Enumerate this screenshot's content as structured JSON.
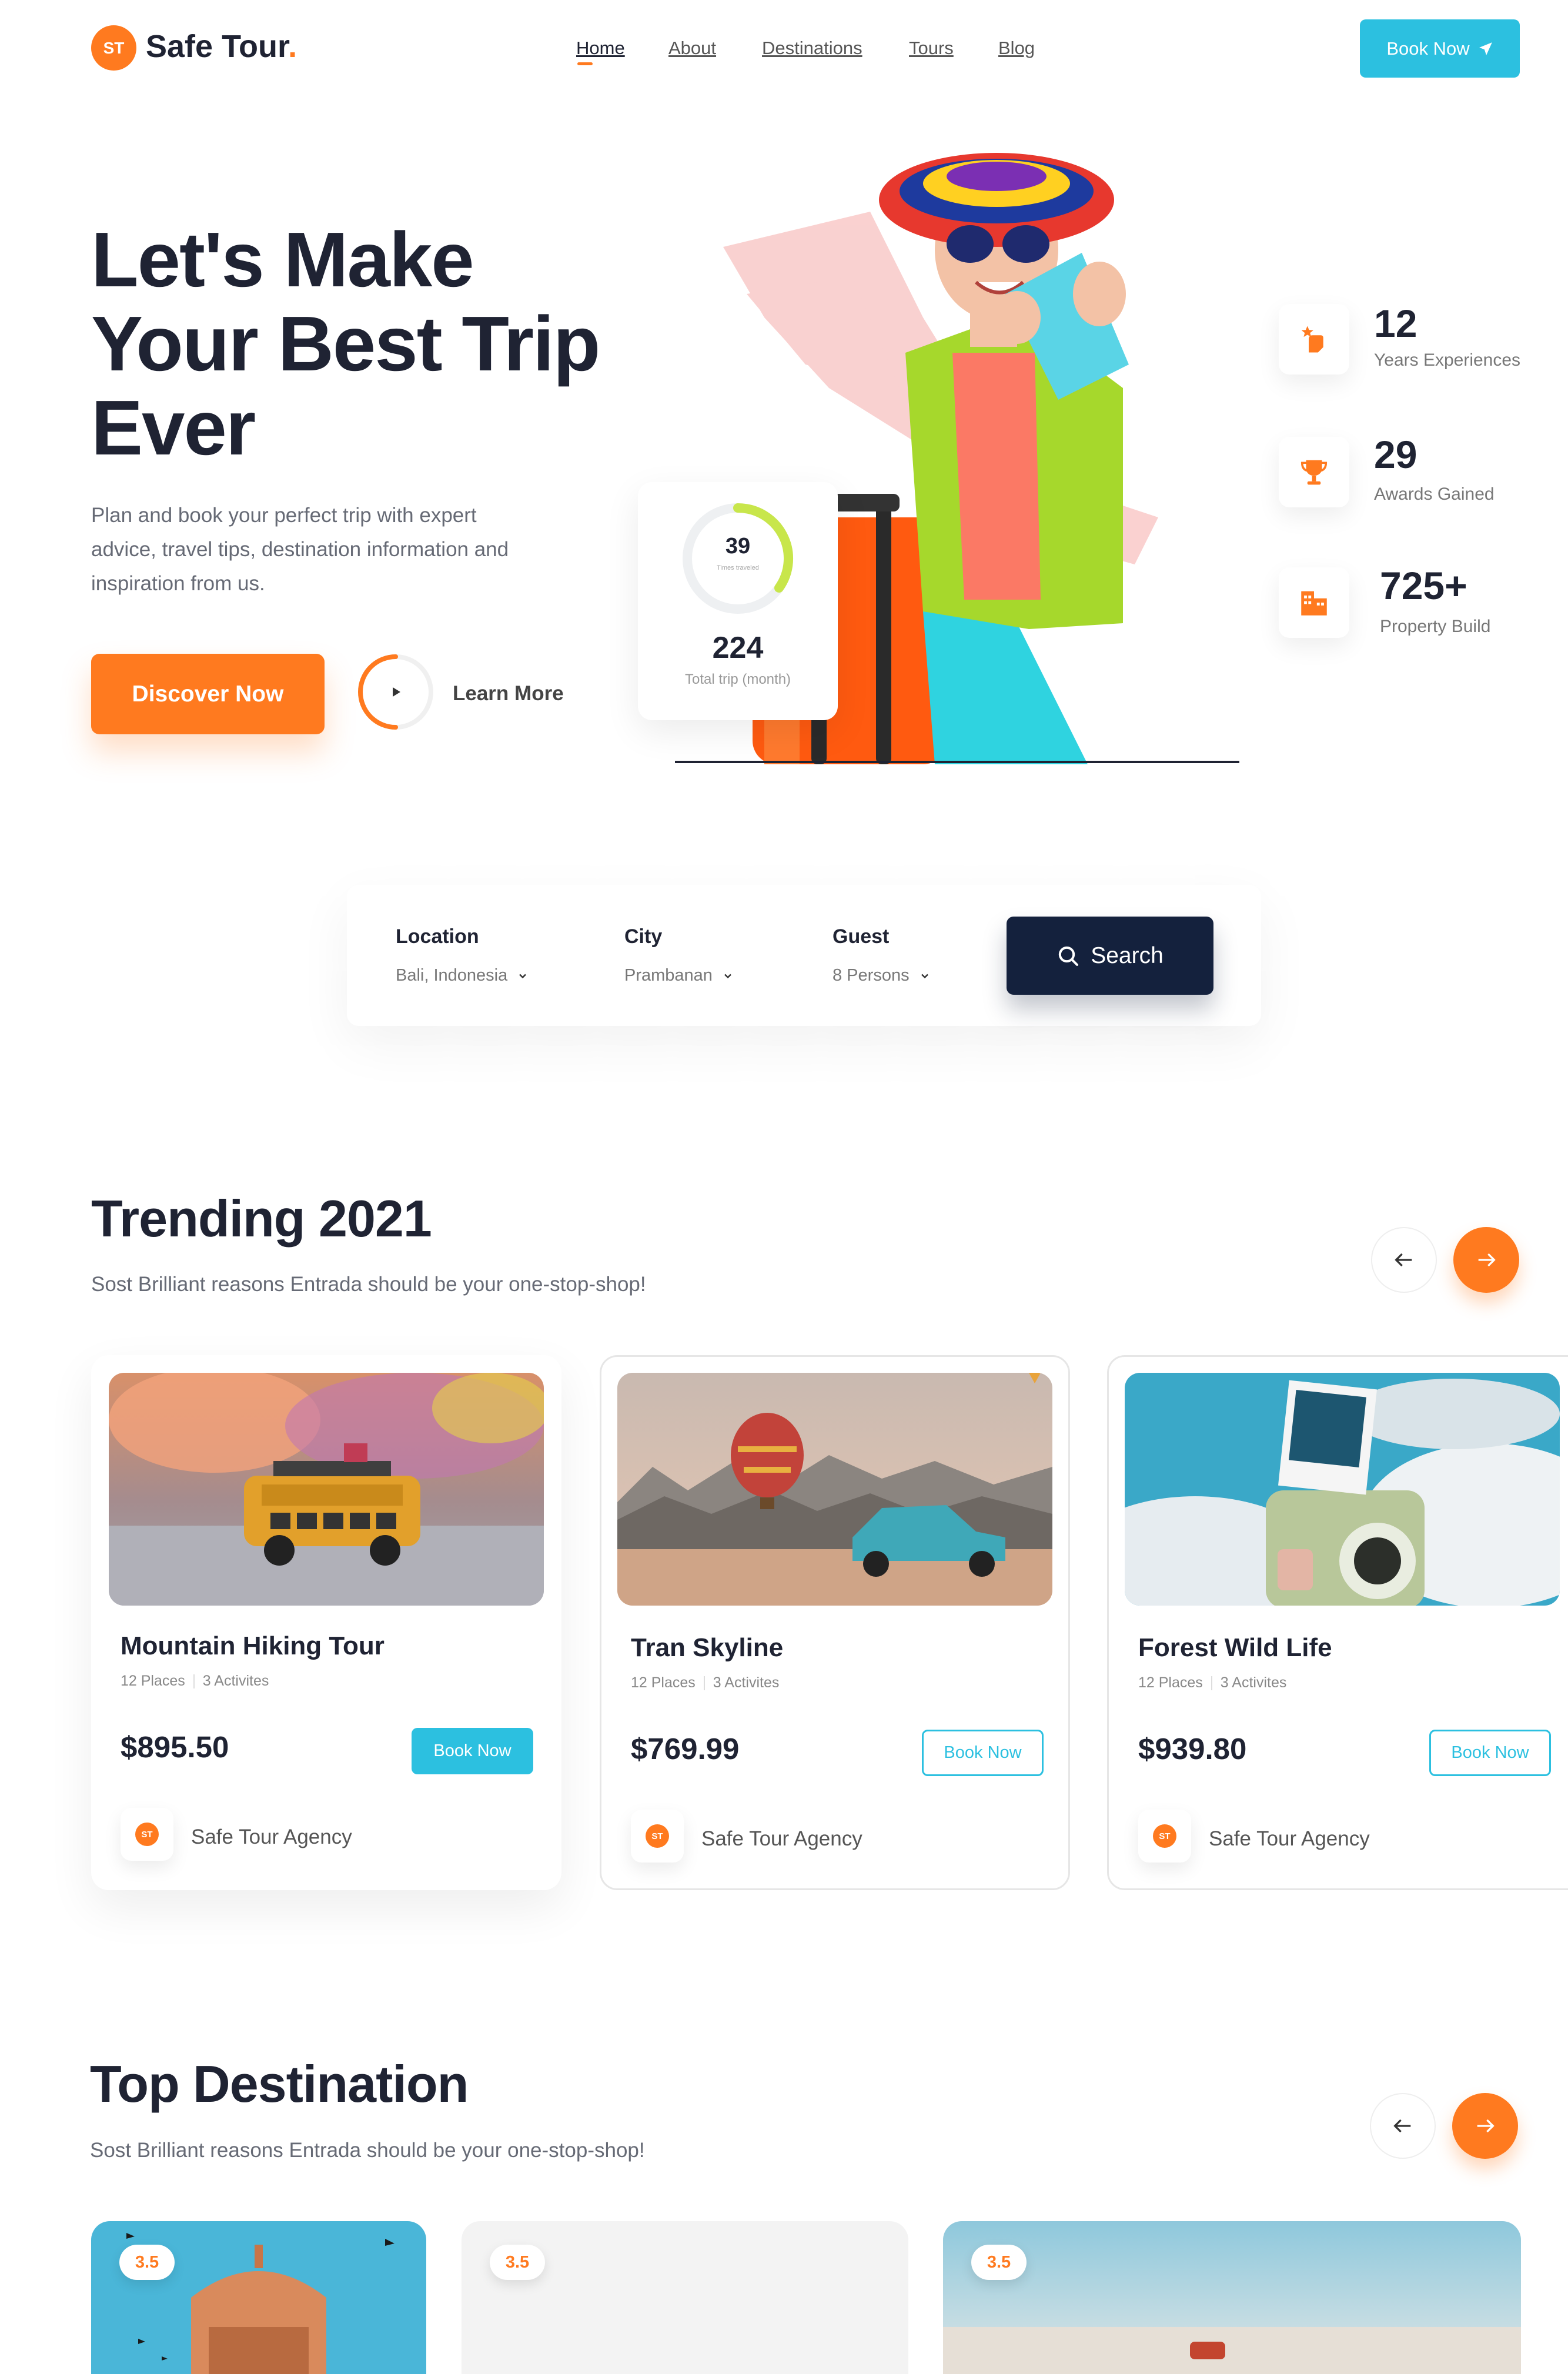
{
  "brand": {
    "badge": "ST",
    "name": "Safe Tour",
    "dot": "."
  },
  "nav": {
    "items": [
      "Home",
      "About",
      "Destinations",
      "Tours",
      "Blog"
    ],
    "active": "Home"
  },
  "header": {
    "book_label": "Book Now"
  },
  "hero": {
    "title_lines": [
      "Let's Make",
      "Your Best Trip",
      "Ever"
    ],
    "description": "Plan and book your perfect trip with expert advice, travel tips, destination information and inspiration from us.",
    "discover_label": "Discover Now",
    "learn_more_label": "Learn More",
    "stat_card": {
      "ring_value": "39",
      "ring_caption": "Times traveled",
      "total": "224",
      "total_caption": "Total trip (month)"
    }
  },
  "stats": [
    {
      "value": "12",
      "label": "Years Experiences",
      "icon": "hand-star-icon"
    },
    {
      "value": "29",
      "label": "Awards Gained",
      "icon": "trophy-icon"
    },
    {
      "value": "725+",
      "label": "Property Build",
      "icon": "building-icon"
    }
  ],
  "search": {
    "fields": [
      {
        "label": "Location",
        "value": "Bali, Indonesia"
      },
      {
        "label": "City",
        "value": "Prambanan"
      },
      {
        "label": "Guest",
        "value": "8 Persons"
      }
    ],
    "button_label": "Search"
  },
  "trending": {
    "title": "Trending 2021",
    "subtitle": "Sost Brilliant reasons Entrada should be your one-stop-shop!",
    "cards": [
      {
        "title": "Mountain Hiking Tour",
        "places": "12 Places",
        "activities": "3 Activites",
        "price": "$895.50",
        "button": "Book Now",
        "agency": "Safe Tour Agency",
        "badge": "ST"
      },
      {
        "title": "Tran Skyline",
        "places": "12 Places",
        "activities": "3 Activites",
        "price": "$769.99",
        "button": "Book Now",
        "agency": "Safe Tour Agency",
        "badge": "ST"
      },
      {
        "title": "Forest Wild Life",
        "places": "12 Places",
        "activities": "3 Activites",
        "price": "$939.80",
        "button": "Book Now",
        "agency": "Safe Tour Agency",
        "badge": "ST"
      }
    ]
  },
  "top_destination": {
    "title": "Top Destination",
    "subtitle": "Sost Brilliant reasons Entrada should be your one-stop-shop!",
    "cards": [
      {
        "rating": "3.5"
      },
      {
        "rating": "3.5"
      },
      {
        "rating": "3.5"
      }
    ]
  },
  "colors": {
    "accent": "#ff7a1f",
    "cyan": "#2cc0e0",
    "navy": "#14213d",
    "text": "#1f2333"
  }
}
